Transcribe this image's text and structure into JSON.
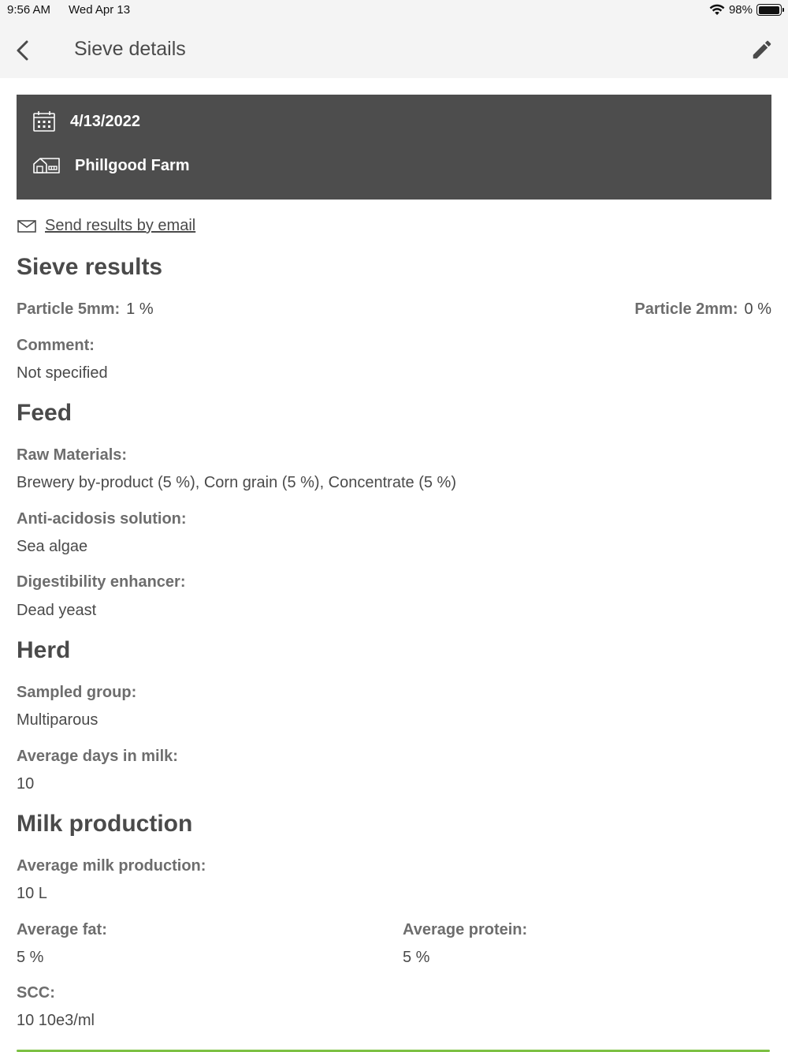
{
  "status": {
    "time": "9:56 AM",
    "date": "Wed Apr 13",
    "battery": "98%",
    "battery_level": 0.98
  },
  "nav": {
    "title": "Sieve details"
  },
  "card": {
    "date": "4/13/2022",
    "farm": "Phillgood Farm"
  },
  "email": {
    "label": "Send results by email"
  },
  "sieve": {
    "title": "Sieve results",
    "p5_label": "Particle 5mm:",
    "p5_value": "1 %",
    "p2_label": "Particle 2mm:",
    "p2_value": "0 %",
    "comment_label": "Comment:",
    "comment_value": "Not specified"
  },
  "feed": {
    "title": "Feed",
    "raw_label": "Raw Materials:",
    "raw_value": "Brewery by-product (5 %), Corn grain (5 %), Concentrate (5 %)",
    "acid_label": "Anti-acidosis solution:",
    "acid_value": "Sea algae",
    "digest_label": "Digestibility enhancer:",
    "digest_value": "Dead yeast"
  },
  "herd": {
    "title": "Herd",
    "group_label": "Sampled group:",
    "group_value": "Multiparous",
    "days_label": "Average days in milk:",
    "days_value": "10"
  },
  "milk": {
    "title": "Milk production",
    "prod_label": "Average milk production:",
    "prod_value": "10 L",
    "fat_label": "Average fat:",
    "fat_value": "5 %",
    "protein_label": "Average protein:",
    "protein_value": "5 %",
    "scc_label": "SCC:",
    "scc_value": "10 10e3/ml"
  }
}
